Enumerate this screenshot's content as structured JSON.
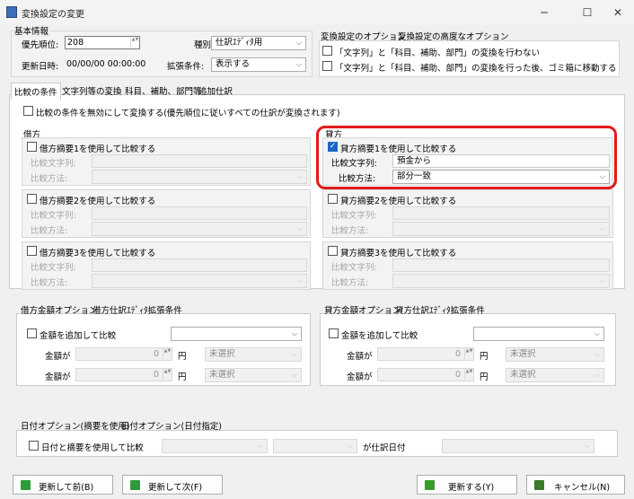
{
  "window": {
    "title": "変換設定の変更",
    "min": "─",
    "max": "☐",
    "close": "✕"
  },
  "basic": {
    "legend": "基本情報",
    "priority_label": "優先順位:",
    "priority_value": "208",
    "type_label": "種別:",
    "type_value": "仕訳ｴﾃﾞｨﾀ用",
    "updated_label": "更新日時:",
    "updated_value": "00/00/00 00:00:00",
    "ext_label": "拡張条件:",
    "ext_value": "表示する"
  },
  "options": {
    "tab1": "変換設定のオプション",
    "tab2": "変換設定の高度なオプション",
    "opt1": "「文字列」と「科目、補助、部門」の変換を行わない",
    "opt2": "「文字列」と「科目、補助、部門」の変換を行った後、ゴミ箱に移動する"
  },
  "tabs": [
    "比較の条件",
    "文字列等の変換",
    "科目、補助、部門等",
    "追加仕訳"
  ],
  "disable_all": "比較の条件を無効にして変換する(優先順位に従いすべての仕訳が変換されます)",
  "debit": {
    "legend": "借方",
    "g1": "借方摘要1を使用して比較する",
    "g2": "借方摘要2を使用して比較する",
    "g3": "借方摘要3を使用して比較する",
    "str_label": "比較文字列:",
    "method_label": "比較方法:"
  },
  "credit": {
    "legend": "貸方",
    "g1": "貸方摘要1を使用して比較する",
    "g1_str": "預金から",
    "g1_method": "部分一致",
    "g2": "貸方摘要2を使用して比較する",
    "g3": "貸方摘要3を使用して比較する",
    "str_label": "比較文字列:",
    "method_label": "比較方法:"
  },
  "debit_amt": {
    "tab1": "借方金額オプション",
    "tab2": "借方仕訳ｴﾃﾞｨﾀ拡張条件",
    "add": "金額を追加して比較",
    "amt": "金額が",
    "val": "0",
    "yen": "円",
    "sel": "未選択"
  },
  "credit_amt": {
    "tab1": "貸方金額オプション",
    "tab2": "貸方仕訳ｴﾃﾞｨﾀ拡張条件",
    "add": "金額を追加して比較",
    "amt": "金額が",
    "val": "0",
    "yen": "円",
    "sel": "未選択"
  },
  "date": {
    "tab1": "日付オプション(摘要を使用)",
    "tab2": "日付オプション(日付指定)",
    "check": "日付と摘要を使用して比較",
    "suffix": "が仕訳日付"
  },
  "buttons": {
    "prev": "更新して前(B)",
    "next": "更新して次(F)",
    "update": "更新する(Y)",
    "cancel": "キャンセル(N)"
  },
  "icons": {
    "chev": "⌵",
    "check": "✓",
    "spin": "▲▼"
  }
}
